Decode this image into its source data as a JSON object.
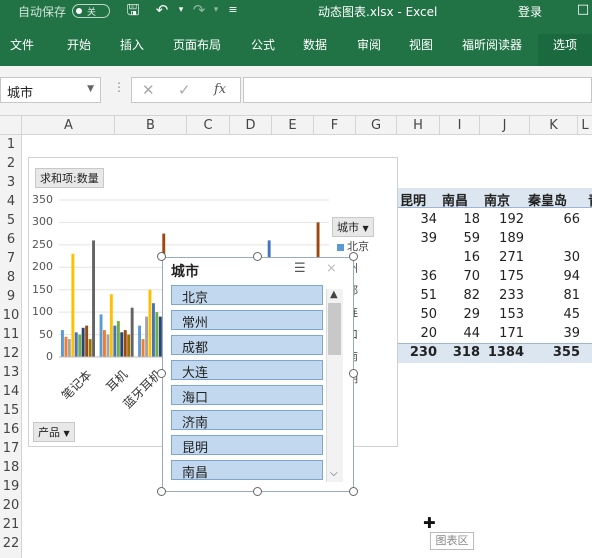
{
  "title_bar": {
    "autosave_label": "自动保存",
    "autosave_state": "关",
    "doc_title": "动态图表.xlsx  -  Excel",
    "login": "登录"
  },
  "ribbon": {
    "tabs": [
      "文件",
      "开始",
      "插入",
      "页面布局",
      "公式",
      "数据",
      "审阅",
      "视图",
      "福昕阅读器",
      "选项"
    ],
    "selected_tab": "选项"
  },
  "formula_bar": {
    "name_box": "城市",
    "fx": "fx"
  },
  "columns": [
    "A",
    "B",
    "C",
    "D",
    "E",
    "F",
    "G",
    "H",
    "I",
    "J",
    "K",
    "L"
  ],
  "rows": [
    "1",
    "2",
    "3",
    "4",
    "5",
    "6",
    "7",
    "8",
    "9",
    "10",
    "11",
    "12",
    "13",
    "14",
    "15",
    "16",
    "17",
    "18",
    "19",
    "20",
    "21",
    "22"
  ],
  "pivot": {
    "headers": [
      "昆明",
      "南昌",
      "南京",
      "秦皇岛"
    ],
    "rows": [
      [
        "34",
        "18",
        "192",
        "66"
      ],
      [
        "39",
        "59",
        "189",
        ""
      ],
      [
        "",
        "16",
        "271",
        "30"
      ],
      [
        "36",
        "70",
        "175",
        "94"
      ],
      [
        "51",
        "82",
        "233",
        "81"
      ],
      [
        "50",
        "29",
        "153",
        "45"
      ],
      [
        "20",
        "44",
        "171",
        "39"
      ]
    ],
    "totals": [
      "230",
      "318",
      "1384",
      "355"
    ]
  },
  "chart": {
    "value_field": "求和项:数量",
    "legend_field": "城市",
    "axis_field": "产品",
    "legend_items": [
      {
        "label": "北京",
        "color": "#5b9bd5"
      },
      {
        "label": "州",
        "color": "#ed7d31"
      },
      {
        "label": "都",
        "color": "#a5a5a5"
      },
      {
        "label": "连",
        "color": "#ffc000"
      },
      {
        "label": "口",
        "color": "#4472c4"
      },
      {
        "label": "南",
        "color": "#70ad47"
      },
      {
        "label": "明",
        "color": "#264478"
      }
    ]
  },
  "chart_data": {
    "type": "bar",
    "yticks": [
      "350",
      "300",
      "250",
      "200",
      "150",
      "100",
      "50",
      "0"
    ],
    "ylim": [
      0,
      350
    ],
    "categories": [
      "笔记本",
      "耳机",
      "蓝牙耳机"
    ],
    "series_colors": [
      "#5b9bd5",
      "#ed7d31",
      "#a5a5a5",
      "#ffc000",
      "#4472c4",
      "#70ad47",
      "#264478",
      "#9e480e",
      "#997300",
      "#636363"
    ],
    "groups": [
      [
        60,
        45,
        40,
        230,
        55,
        50,
        65,
        70,
        40,
        260
      ],
      [
        95,
        60,
        50,
        140,
        70,
        80,
        55,
        60,
        50,
        110
      ],
      [
        70,
        40,
        90,
        150,
        120,
        100,
        90,
        275,
        60,
        40
      ],
      [
        50,
        40,
        40,
        120,
        90,
        70,
        80,
        50,
        40,
        150
      ],
      [
        60,
        50,
        40,
        180,
        60,
        60,
        40,
        40,
        50,
        80
      ],
      [
        140,
        60,
        50,
        90,
        260,
        60,
        60,
        40,
        40,
        70
      ],
      [
        80,
        70,
        60,
        200,
        70,
        60,
        50,
        300,
        60,
        60
      ]
    ]
  },
  "slicer": {
    "title": "城市",
    "items": [
      "北京",
      "常州",
      "成都",
      "大连",
      "海口",
      "济南",
      "昆明",
      "南昌"
    ]
  },
  "tooltip": "图表区"
}
